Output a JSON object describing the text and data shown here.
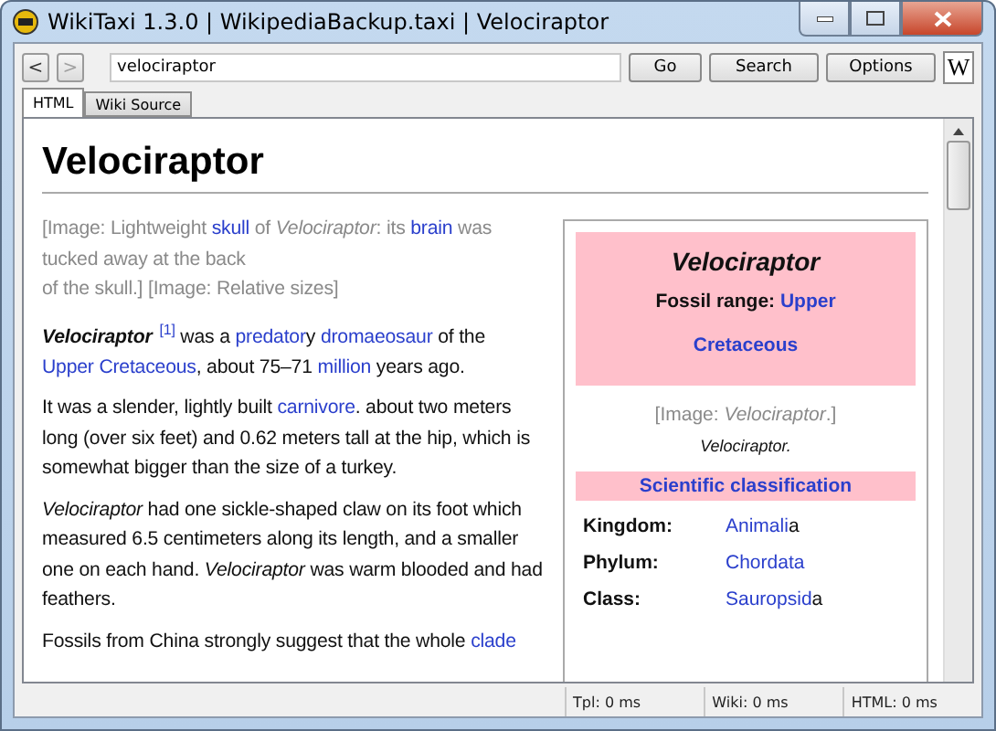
{
  "window": {
    "title": "WikiTaxi 1.3.0 | WikipediaBackup.taxi | Velociraptor"
  },
  "toolbar": {
    "back": "<",
    "forward": ">",
    "address": "velociraptor",
    "buttons": [
      "Go",
      "Search",
      "Options"
    ],
    "wiki_button": "W"
  },
  "tabs": [
    {
      "label": "HTML",
      "selected": true
    },
    {
      "label": "Wiki Source",
      "selected": false
    }
  ],
  "article": {
    "heading": "Velociraptor",
    "paragraphs": [
      {
        "kind": "caption",
        "segments": [
          {
            "kind": "plain",
            "text": "[Image: Lightweight "
          },
          {
            "kind": "link",
            "text": "skull"
          },
          {
            "kind": "plain",
            "text": " of "
          },
          {
            "kind": "italic",
            "text": "Velociraptor"
          },
          {
            "kind": "plain",
            "text": ": its "
          },
          {
            "kind": "link",
            "text": "brain"
          },
          {
            "kind": "plain",
            "text": " was tucked away at the back"
          },
          {
            "kind": "break"
          },
          {
            "kind": "plain",
            "text": "of the skull.] [Image: Relative sizes]"
          }
        ]
      },
      {
        "kind": "body",
        "segments": [
          {
            "kind": "bold-italic",
            "text": "Velociraptor"
          },
          {
            "kind": "sup-link",
            "text": "[1]"
          },
          {
            "kind": "plain",
            "text": " was a "
          },
          {
            "kind": "link",
            "text": "predator"
          },
          {
            "kind": "plain",
            "text": "y "
          },
          {
            "kind": "link",
            "text": "dromaeosaur"
          },
          {
            "kind": "plain",
            "text": " of the "
          },
          {
            "kind": "link",
            "text": "Upper Cretaceous"
          },
          {
            "kind": "plain",
            "text": ", about 75–71 "
          },
          {
            "kind": "link",
            "text": "million"
          },
          {
            "kind": "plain",
            "text": " years ago."
          }
        ]
      },
      {
        "kind": "body",
        "segments": [
          {
            "kind": "plain",
            "text": "It was a slender, lightly built "
          },
          {
            "kind": "link",
            "text": "carnivore"
          },
          {
            "kind": "plain",
            "text": ". about two meters long (over six feet) and 0.62 meters tall at the hip, which is somewhat bigger than the size of a turkey."
          }
        ]
      },
      {
        "kind": "body",
        "segments": [
          {
            "kind": "italic",
            "text": "Velociraptor"
          },
          {
            "kind": "plain",
            "text": " had one sickle-shaped claw on its foot which measured 6.5 centimeters along its length, and a smaller one on each hand. "
          },
          {
            "kind": "italic",
            "text": "Velociraptor"
          },
          {
            "kind": "plain",
            "text": " was warm blooded and had feathers."
          }
        ]
      },
      {
        "kind": "body",
        "segments": [
          {
            "kind": "plain",
            "text": "Fossils from China strongly suggest that the whole "
          },
          {
            "kind": "link",
            "text": "clade"
          }
        ]
      }
    ],
    "infobox": {
      "title": "Velociraptor",
      "range_label": "Fossil range:",
      "range_links": [
        "Upper",
        "Cretaceous"
      ],
      "image_caption": [
        {
          "kind": "plain",
          "text": "[Image: "
        },
        {
          "kind": "italic",
          "text": "Velociraptor"
        },
        {
          "kind": "plain",
          "text": ".]"
        }
      ],
      "caption": "Velociraptor.",
      "section": "Scientific classification",
      "rows": [
        {
          "label": "Kingdom:",
          "value": [
            {
              "kind": "link",
              "text": "Animali"
            },
            {
              "kind": "plain",
              "text": "a"
            }
          ]
        },
        {
          "label": "Phylum:",
          "value": [
            {
              "kind": "link",
              "text": "Chordata"
            }
          ]
        },
        {
          "label": "Class:",
          "value": [
            {
              "kind": "link",
              "text": "Sauropsid"
            },
            {
              "kind": "plain",
              "text": "a"
            }
          ]
        }
      ]
    }
  },
  "status_bar": [
    "Tpl: 0 ms",
    "Wiki: 0 ms",
    "HTML: 0 ms"
  ]
}
